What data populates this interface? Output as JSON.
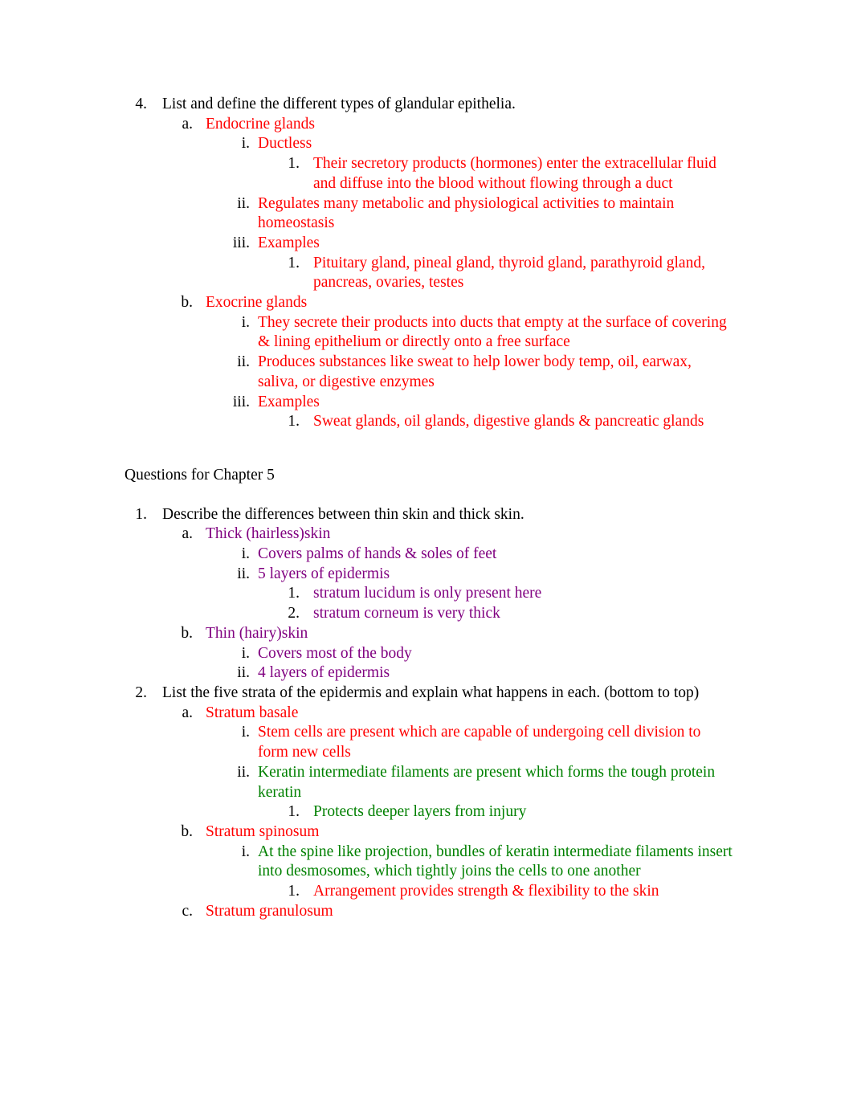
{
  "document": {
    "colors": {
      "black": "#000000",
      "red": "#ff0000",
      "green": "#008000",
      "purple": "#800080"
    },
    "section_heading": "Questions for Chapter 5",
    "blocks": [
      {
        "marker": "4.",
        "color": "black",
        "text": "List and define the different types of glandular epithelia.",
        "children": [
          {
            "marker": "a.",
            "color": "red",
            "text": "Endocrine glands",
            "children": [
              {
                "marker": "i.",
                "color": "red",
                "text": "Ductless",
                "children": [
                  {
                    "marker": "1.",
                    "color": "red",
                    "text": "Their secretory products (hormones) enter the extracellular fluid and diffuse into the blood without flowing through a duct"
                  }
                ]
              },
              {
                "marker": "ii.",
                "color": "red",
                "text": "Regulates many metabolic and physiological activities to maintain homeostasis"
              },
              {
                "marker": "iii.",
                "color": "red",
                "text": "Examples",
                "children": [
                  {
                    "marker": "1.",
                    "color": "red",
                    "text": "Pituitary gland, pineal gland, thyroid gland, parathyroid gland, pancreas, ovaries, testes"
                  }
                ]
              }
            ]
          },
          {
            "marker": "b.",
            "color": "red",
            "text": "Exocrine glands",
            "children": [
              {
                "marker": "i.",
                "color": "red",
                "text": "They secrete their products into ducts that empty at the surface of covering & lining epithelium or directly onto a free surface"
              },
              {
                "marker": "ii.",
                "color": "red",
                "text": "Produces substances like sweat to help lower body temp, oil, earwax, saliva, or digestive enzymes"
              },
              {
                "marker": "iii.",
                "color": "red",
                "text": "Examples",
                "children": [
                  {
                    "marker": "1.",
                    "color": "red",
                    "text": "Sweat glands, oil glands, digestive glands & pancreatic glands"
                  }
                ]
              }
            ]
          }
        ]
      },
      {
        "marker": "1.",
        "color": "black",
        "text": "Describe the differences between thin skin and thick skin.",
        "children": [
          {
            "marker": "a.",
            "color": "purple",
            "text": "Thick (hairless)skin",
            "children": [
              {
                "marker": "i.",
                "color": "purple",
                "text": "Covers palms of hands & soles of feet"
              },
              {
                "marker": "ii.",
                "color": "purple",
                "text": "5 layers of epidermis",
                "children": [
                  {
                    "marker": "1.",
                    "color": "purple",
                    "text": "stratum lucidum is only present here"
                  },
                  {
                    "marker": "2.",
                    "color": "purple",
                    "text": "stratum corneum is very thick"
                  }
                ]
              }
            ]
          },
          {
            "marker": "b.",
            "color": "purple",
            "text": "Thin (hairy)skin",
            "children": [
              {
                "marker": "i.",
                "color": "purple",
                "text": "Covers most of the body"
              },
              {
                "marker": "ii.",
                "color": "purple",
                "text": "4 layers of epidermis"
              }
            ]
          }
        ]
      },
      {
        "marker": "2.",
        "color": "black",
        "text": "List the five strata of the epidermis and explain what happens in each. (bottom to top)",
        "children": [
          {
            "marker": "a.",
            "color": "red",
            "text": "Stratum basale",
            "children": [
              {
                "marker": "i.",
                "color": "red",
                "text": "Stem cells are present which are capable of undergoing cell division to form new cells"
              },
              {
                "marker": "ii.",
                "color": "green",
                "text": "Keratin intermediate filaments are present which forms the tough protein keratin",
                "children": [
                  {
                    "marker": "1.",
                    "color": "green",
                    "text": "Protects deeper layers from injury"
                  }
                ]
              }
            ]
          },
          {
            "marker": "b.",
            "color": "red",
            "text": "Stratum spinosum",
            "children": [
              {
                "marker": "i.",
                "color": "green",
                "text": "At the spine like projection, bundles of keratin intermediate filaments insert into desmosomes, which tightly joins the cells to one another",
                "children": [
                  {
                    "marker": "1.",
                    "color": "red",
                    "text": "Arrangement provides strength & flexibility to the skin"
                  }
                ]
              }
            ]
          },
          {
            "marker": "c.",
            "color": "red",
            "text": "Stratum granulosum"
          }
        ]
      }
    ]
  }
}
